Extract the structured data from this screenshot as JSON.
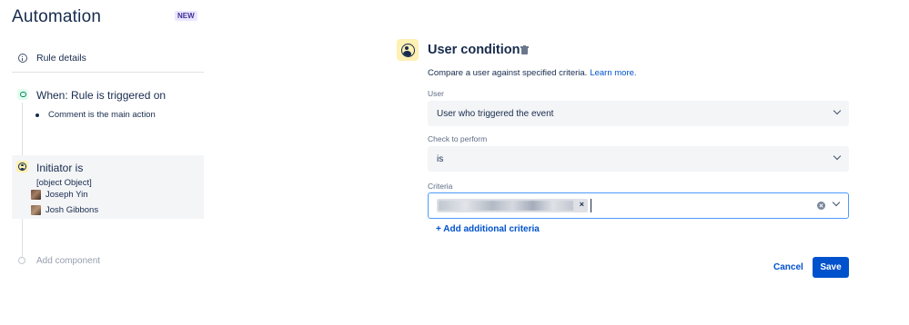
{
  "app": {
    "title": "Automation",
    "badge": "NEW"
  },
  "sidebar": {
    "rule_details": {
      "label": "Rule details",
      "icon": "info-icon"
    },
    "trigger": {
      "title": "When: Rule is triggered on",
      "detail": "Comment is the main action",
      "icon": "comment-icon",
      "icon_color": "#00875a"
    },
    "condition": {
      "title": "Initiator is",
      "value_text": "[object Object]",
      "icon": "user-icon",
      "users": [
        {
          "name": "Joseph Yin"
        },
        {
          "name": "Josh Gibbons"
        }
      ]
    },
    "add_component": {
      "label": "Add component"
    }
  },
  "panel": {
    "title": "User condition",
    "icon": "user-icon",
    "icon_bg": "#fff0b3",
    "description": "Compare a user against specified criteria.",
    "learn_more": "Learn more.",
    "fields": {
      "user": {
        "label": "User",
        "value": "User who triggered the event"
      },
      "check": {
        "label": "Check to perform",
        "value": "is"
      },
      "criteria": {
        "label": "Criteria",
        "chip_remove": "×"
      }
    },
    "add_criteria": "+ Add additional criteria",
    "buttons": {
      "cancel": "Cancel",
      "save": "Save"
    },
    "accent_color": "#0052cc"
  }
}
